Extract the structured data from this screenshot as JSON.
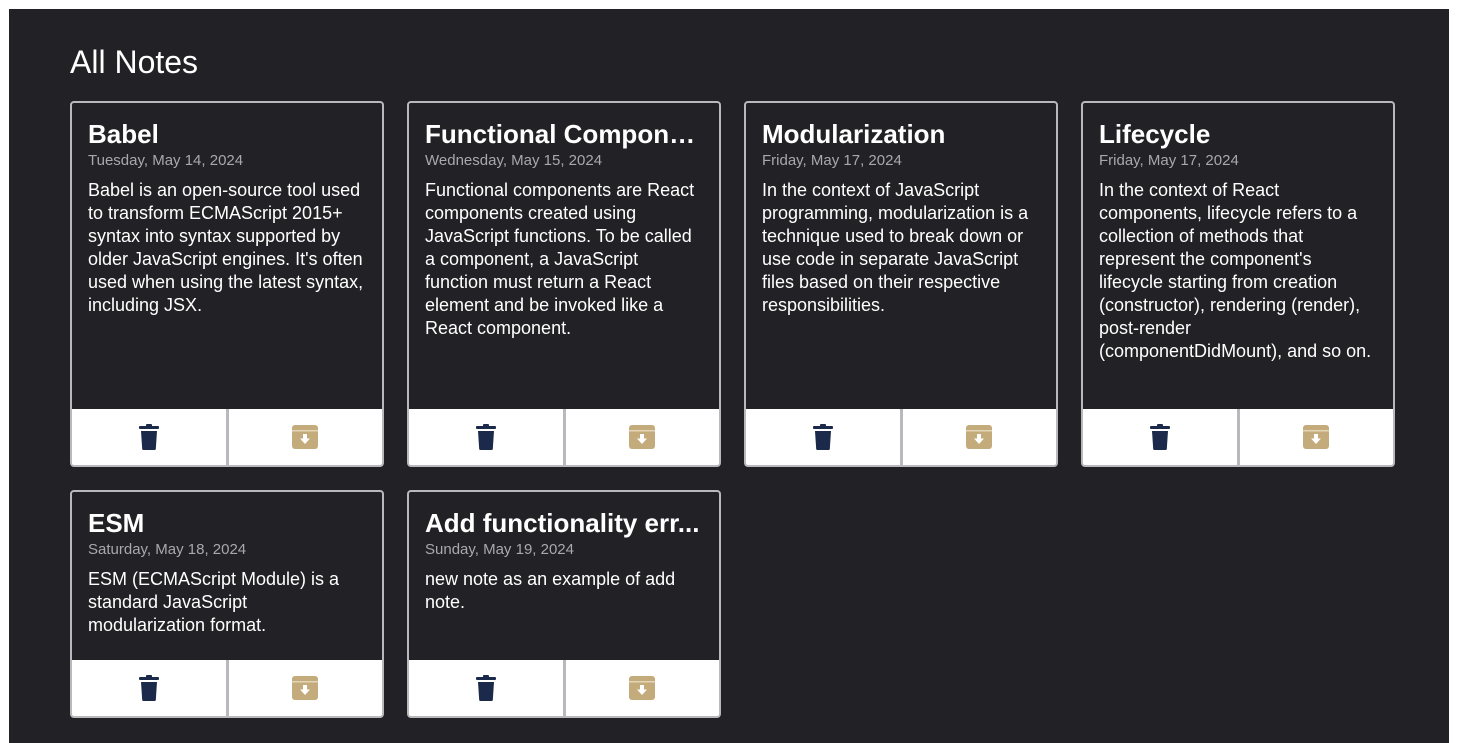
{
  "page": {
    "title": "All Notes"
  },
  "colors": {
    "background": "#222125",
    "card_border": "#b9b9bd",
    "delete_icon": "#1b2a4a",
    "archive_icon": "#c3ab7c"
  },
  "notes": [
    {
      "title": "Babel",
      "date": "Tuesday, May 14, 2024",
      "body": "Babel is an open-source tool used to transform ECMAScript 2015+ syntax into syntax supported by older JavaScript engines. It's often used when using the latest syntax, including JSX."
    },
    {
      "title": "Functional Compone...",
      "date": "Wednesday, May 15, 2024",
      "body": "Functional components are React components created using JavaScript functions. To be called a component, a JavaScript function must return a React element and be invoked like a React component."
    },
    {
      "title": "Modularization",
      "date": "Friday, May 17, 2024",
      "body": "In the context of JavaScript programming, modularization is a technique used to break down or use code in separate JavaScript files based on their respective responsibilities."
    },
    {
      "title": "Lifecycle",
      "date": "Friday, May 17, 2024",
      "body": "In the context of React components, lifecycle refers to a collection of methods that represent the component's lifecycle starting from creation (constructor), rendering (render), post-render (componentDidMount), and so on."
    },
    {
      "title": "ESM",
      "date": "Saturday, May 18, 2024",
      "body": "ESM (ECMAScript Module) is a standard JavaScript modularization format."
    },
    {
      "title": "Add functionality err...",
      "date": "Sunday, May 19, 2024",
      "body": "new note as an example of add note."
    }
  ],
  "icons": {
    "delete": "trash-icon",
    "archive": "archive-icon"
  }
}
